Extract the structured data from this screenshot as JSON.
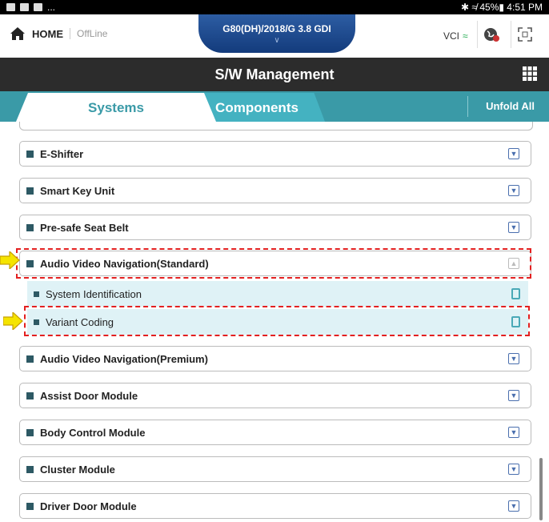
{
  "statusbar": {
    "right_text": "✱ ≉ 45%▮ 4:51 PM",
    "left_text": "..."
  },
  "header": {
    "home_label": "HOME",
    "offline_label": "OffLine",
    "vehicle": "G80(DH)/2018/G 3.8 GDI",
    "vci_label": "VCI"
  },
  "title": "S/W Management",
  "tabs": {
    "systems": "Systems",
    "components": "Components",
    "unfold": "Unfold All"
  },
  "items": [
    {
      "label": "E-Shifter"
    },
    {
      "label": "Smart Key Unit"
    },
    {
      "label": "Pre-safe Seat Belt"
    },
    {
      "label": "Audio Video Navigation(Standard)"
    },
    {
      "label": "Audio Video Navigation(Premium)"
    },
    {
      "label": "Assist Door Module"
    },
    {
      "label": "Body Control Module"
    },
    {
      "label": "Cluster Module"
    },
    {
      "label": "Driver Door Module"
    }
  ],
  "subitems": [
    {
      "label": "System Identification"
    },
    {
      "label": "Variant Coding"
    }
  ],
  "colors": {
    "accent": "#3a9aa7",
    "highlight": "#e32020",
    "arrow": "#f5e400"
  }
}
